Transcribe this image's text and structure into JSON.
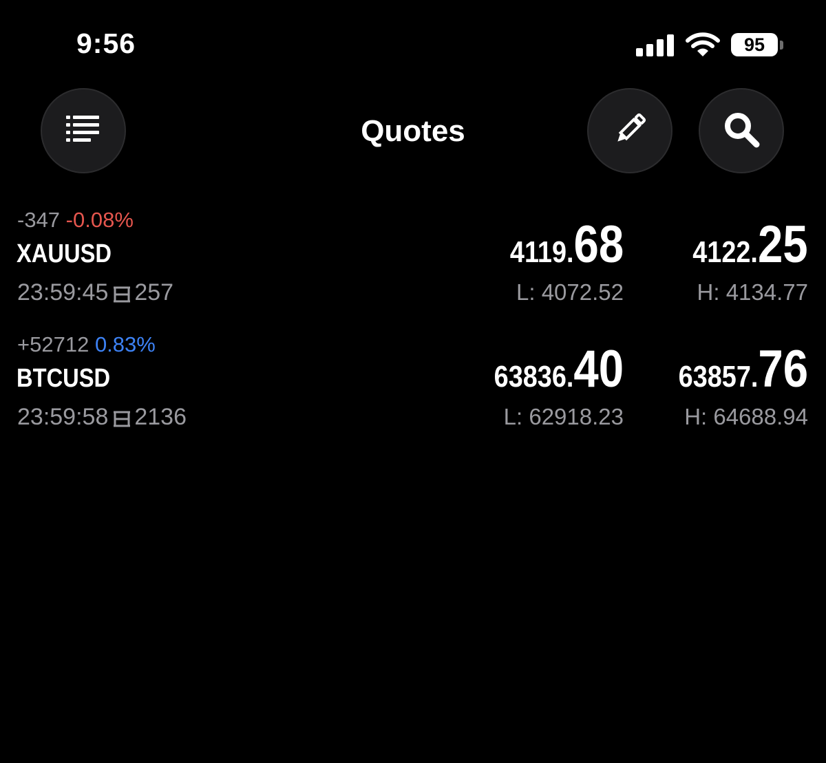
{
  "status_bar": {
    "time": "9:56",
    "battery": "95"
  },
  "header": {
    "title": "Quotes"
  },
  "icons": {
    "menu": "list-icon",
    "edit": "pencil-icon",
    "search": "search-icon"
  },
  "colors": {
    "negative": "#e5564e",
    "positive": "#3d82f5",
    "secondary_text": "#9a9a9f",
    "button_bg": "#1c1c1e"
  },
  "quotes": [
    {
      "change_points": "-347",
      "change_pct": "-0.08%",
      "direction": "down",
      "symbol": "XAUUSD",
      "time": "23:59:45",
      "spread": "257",
      "bid_main": "4119.",
      "bid_big": "68",
      "ask_main": "4122.",
      "ask_big": "25",
      "low": "L: 4072.52",
      "high": "H: 4134.77"
    },
    {
      "change_points": "+52712",
      "change_pct": "0.83%",
      "direction": "up",
      "symbol": "BTCUSD",
      "time": "23:59:58",
      "spread": "2136",
      "bid_main": "63836.",
      "bid_big": "40",
      "ask_main": "63857.",
      "ask_big": "76",
      "low": "L: 62918.23",
      "high": "H: 64688.94"
    }
  ]
}
